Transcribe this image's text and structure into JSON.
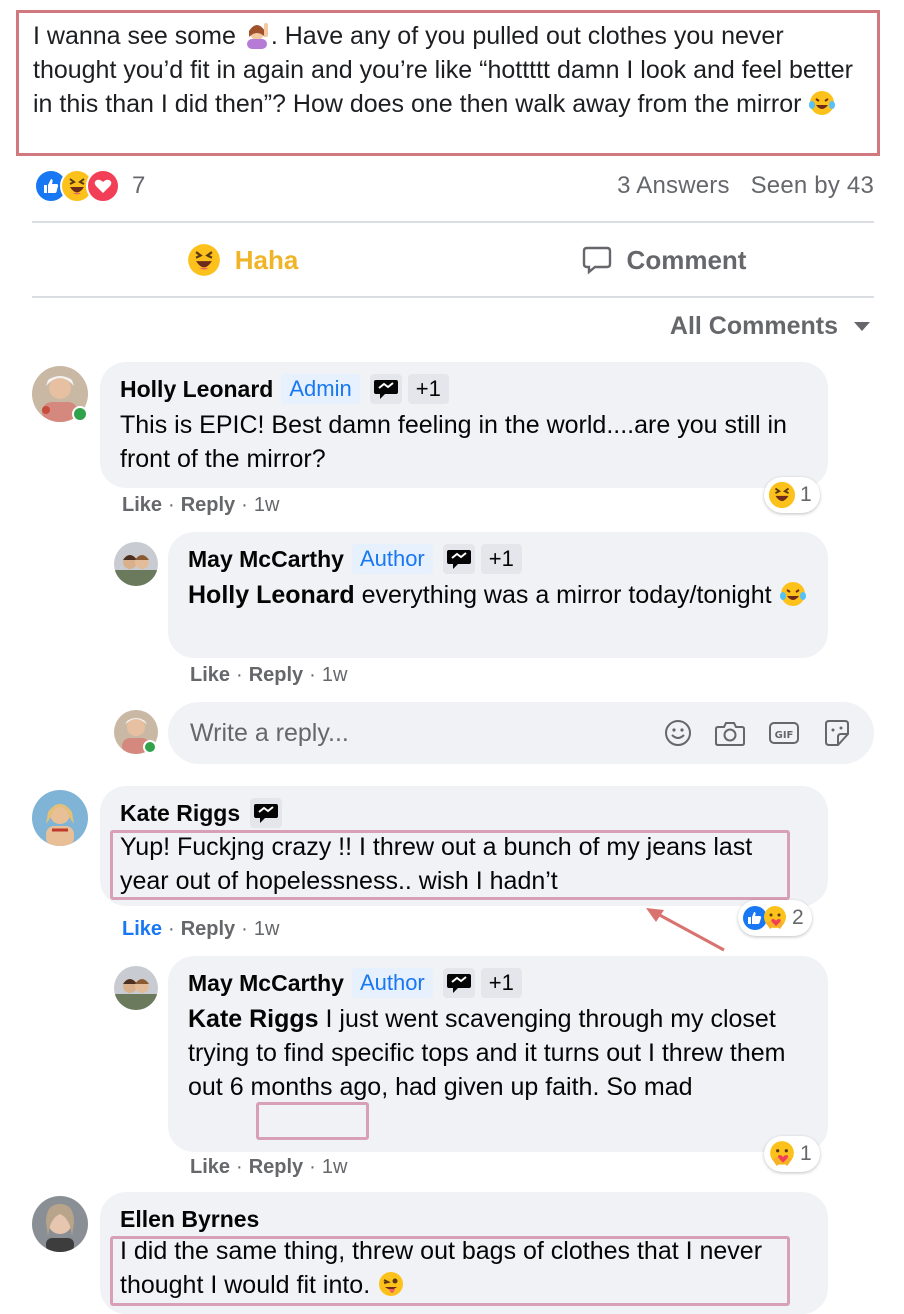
{
  "post": {
    "text_part1": "I wanna see some ",
    "text_part2": ". Have any of you pulled out clothes you never thought you’d fit in again and you’re like “hottttt damn I look and feel better in this than I did then”? How does one then walk away from the mirror ",
    "reaction_count": "7",
    "answers": "3 Answers",
    "seen_by": "Seen by 43"
  },
  "actions": {
    "haha": "Haha",
    "comment": "Comment"
  },
  "sort_label": "All Comments",
  "comments": [
    {
      "name": "Holly Leonard",
      "role": "Admin",
      "plus": "+1",
      "text": "This is EPIC! Best damn feeling in the world....are you still in front of the mirror?",
      "like": "Like",
      "reply": "Reply",
      "time": "1w",
      "reaction_count": "1"
    },
    {
      "name": "May McCarthy",
      "role": "Author",
      "plus": "+1",
      "mention": "Holly Leonard",
      "text": " everything was a mirror today/tonight ",
      "like": "Like",
      "reply": "Reply",
      "time": "1w"
    },
    {
      "name": "Kate Riggs",
      "text": "Yup! Fuckjng crazy !! I threw out a bunch of my jeans last year out of hopelessness.. wish I hadn’t",
      "like": "Like",
      "reply": "Reply",
      "time": "1w",
      "reaction_count": "2"
    },
    {
      "name": "May McCarthy",
      "role": "Author",
      "plus": "+1",
      "mention": "Kate Riggs",
      "text": " I just went scavenging through my closet trying to find specific tops and it turns out I threw them out 6 months ago, had given up faith. ",
      "text_end": "So mad",
      "like": "Like",
      "reply": "Reply",
      "time": "1w",
      "reaction_count": "1"
    },
    {
      "name": "Ellen Byrnes",
      "text": "I did the same thing, threw out bags of clothes that I never thought I would fit into. "
    }
  ],
  "reply_box": {
    "placeholder": "Write a reply..."
  },
  "icons": [
    "like-icon",
    "haha-icon",
    "love-icon",
    "care-icon",
    "comment-icon",
    "smiley-icon",
    "camera-icon",
    "gif-icon",
    "sticker-icon",
    "conversation-starter-icon",
    "woman-raising-hand-icon",
    "laughing-tears-icon",
    "winking-tongue-icon"
  ],
  "colors": {
    "haha": "#f0b429",
    "like_blue": "#1877f2",
    "bubble": "#f0f2f5",
    "highlight_red": "#d07a7f",
    "highlight_pink": "#d8a0b4",
    "online": "#31a24c"
  }
}
